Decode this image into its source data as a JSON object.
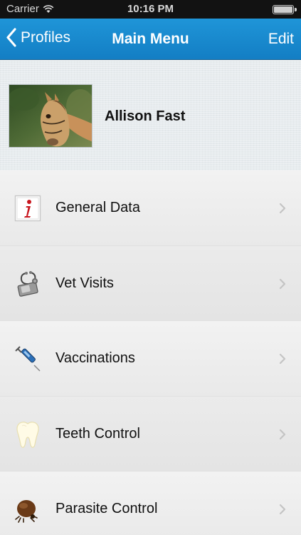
{
  "status_bar": {
    "carrier": "Carrier",
    "time": "10:16 PM"
  },
  "nav": {
    "back_label": "Profiles",
    "title": "Main Menu",
    "edit_label": "Edit"
  },
  "profile": {
    "name": "Allison Fast"
  },
  "menu": {
    "items": [
      {
        "label": "General Data",
        "icon": "info-icon"
      },
      {
        "label": "Vet Visits",
        "icon": "stethoscope-icon"
      },
      {
        "label": "Vaccinations",
        "icon": "syringe-icon"
      },
      {
        "label": "Teeth Control",
        "icon": "tooth-icon"
      },
      {
        "label": "Parasite Control",
        "icon": "tick-icon"
      }
    ]
  },
  "colors": {
    "nav_bar": "#1a8bd0",
    "status_bar": "#121212",
    "info_icon_red": "#c8161e"
  }
}
